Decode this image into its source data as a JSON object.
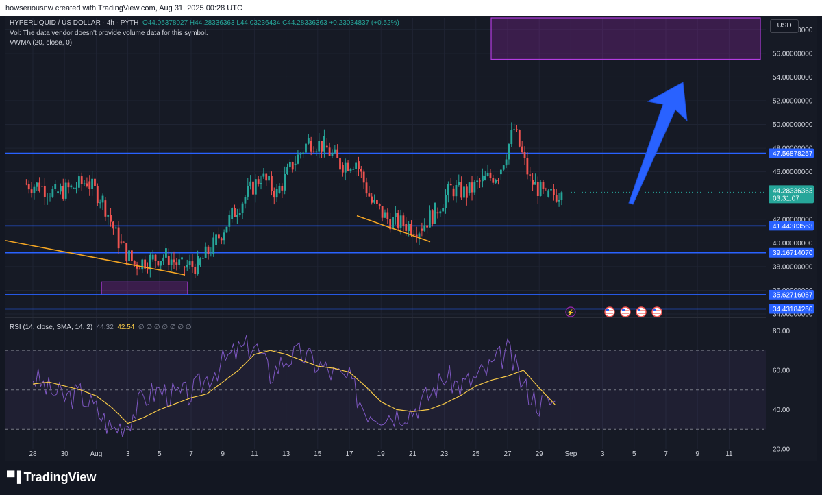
{
  "header": {
    "caption": "howseriousnw created with TradingView.com, Aug 31, 2025 00:28 UTC"
  },
  "legend": {
    "symbol": "HYPERLIQUID / US DOLLAR · 4h · PYTH",
    "open": "O44.05378027",
    "high": "H44.28336363",
    "low": "L44.03236434",
    "close": "C44.28336363",
    "change": "+0.23034837 (+0.52%)",
    "volume_note": "Vol: The data vendor doesn't provide volume data for this symbol.",
    "vwma": "VWMA (20, close, 0)",
    "rsi_label": "RSI (14, close, SMA, 14, 2)",
    "rsi_value": "44.32",
    "rsi_ma_value": "42.54",
    "rsi_extra": "∅ ∅ ∅ ∅ ∅ ∅ ∅"
  },
  "toolbar": {
    "currency_button": "USD"
  },
  "price_axis": {
    "ticks": [
      "58.00000000",
      "56.00000000",
      "54.00000000",
      "52.00000000",
      "50.00000000",
      "48.00000000",
      "46.00000000",
      "42.00000000",
      "40.00000000",
      "38.00000000",
      "36.00000000",
      "34.00000000"
    ],
    "current_price": "44.28336363",
    "countdown": "03:31:07"
  },
  "rsi_axis": {
    "ticks": [
      "80.00",
      "60.00",
      "40.00",
      "20.00"
    ]
  },
  "time_axis": [
    "28",
    "30",
    "Aug",
    "3",
    "5",
    "7",
    "9",
    "11",
    "13",
    "15",
    "17",
    "19",
    "21",
    "23",
    "25",
    "27",
    "29",
    "Sep",
    "3",
    "5",
    "7",
    "9",
    "11"
  ],
  "branding": {
    "logo_text": "TradingView"
  },
  "colors": {
    "background": "#131722",
    "bull": "#26a69a",
    "bear": "#ef5350",
    "level_line": "#2962ff",
    "trendline": "#f5a623",
    "zone": "#9c27b0",
    "arrow": "#2962ff",
    "rsi_line": "#7e57c2",
    "rsi_ma": "#f7c948"
  },
  "chart_data": [
    {
      "type": "candlestick",
      "title": "HYPERLIQUID / US DOLLAR · 4h · PYTH",
      "ylim": [
        34.0,
        59.0
      ],
      "x": [
        "Jul 28",
        "Jul 29",
        "Jul 30",
        "Jul 31",
        "Aug 1",
        "Aug 2",
        "Aug 3",
        "Aug 4",
        "Aug 5",
        "Aug 6",
        "Aug 7",
        "Aug 8",
        "Aug 9",
        "Aug 10",
        "Aug 11",
        "Aug 12",
        "Aug 13",
        "Aug 14",
        "Aug 15",
        "Aug 16",
        "Aug 17",
        "Aug 18",
        "Aug 19",
        "Aug 20",
        "Aug 21",
        "Aug 22",
        "Aug 23",
        "Aug 24",
        "Aug 25",
        "Aug 26",
        "Aug 27",
        "Aug 28",
        "Aug 29",
        "Aug 30"
      ],
      "close": [
        44.8,
        44.2,
        44.6,
        45.2,
        43.6,
        40.1,
        38.2,
        38.6,
        38.9,
        38.0,
        38.1,
        39.8,
        42.0,
        43.9,
        45.6,
        44.2,
        46.6,
        48.6,
        48.2,
        46.6,
        46.9,
        43.4,
        42.0,
        41.6,
        41.2,
        42.6,
        44.6,
        44.2,
        45.3,
        45.8,
        49.6,
        45.3,
        43.9,
        44.28
      ],
      "levels": [
        47.56878257,
        41.44383563,
        39.1671407,
        35.62716057,
        34.4318426
      ],
      "level_labels": [
        "47.56878257",
        "41.44383563",
        "39.16714070",
        "35.62716057",
        "34.43184260"
      ],
      "target_zone": [
        55.5,
        59.0
      ],
      "accumulation_zone": [
        35.6,
        36.7
      ]
    },
    {
      "type": "line",
      "title": "RSI (14, close, SMA, 14, 2)",
      "ylim": [
        20,
        85
      ],
      "series": [
        {
          "name": "RSI",
          "values": [
            57,
            50,
            46,
            48,
            40,
            30,
            34,
            46,
            50,
            47,
            48,
            56,
            64,
            70,
            73,
            58,
            66,
            68,
            63,
            58,
            55,
            40,
            38,
            38,
            40,
            47,
            57,
            52,
            56,
            62,
            70,
            52,
            43,
            44.32
          ]
        },
        {
          "name": "RSI-based MA",
          "values": [
            53,
            54,
            52,
            50,
            47,
            41,
            33,
            36,
            40,
            43,
            46,
            48,
            54,
            60,
            68,
            70,
            68,
            65,
            62,
            61,
            59,
            52,
            44,
            40,
            39,
            40,
            43,
            47,
            52,
            55,
            57,
            60,
            51,
            42.54
          ]
        }
      ],
      "bands": [
        70,
        50,
        30
      ]
    }
  ]
}
